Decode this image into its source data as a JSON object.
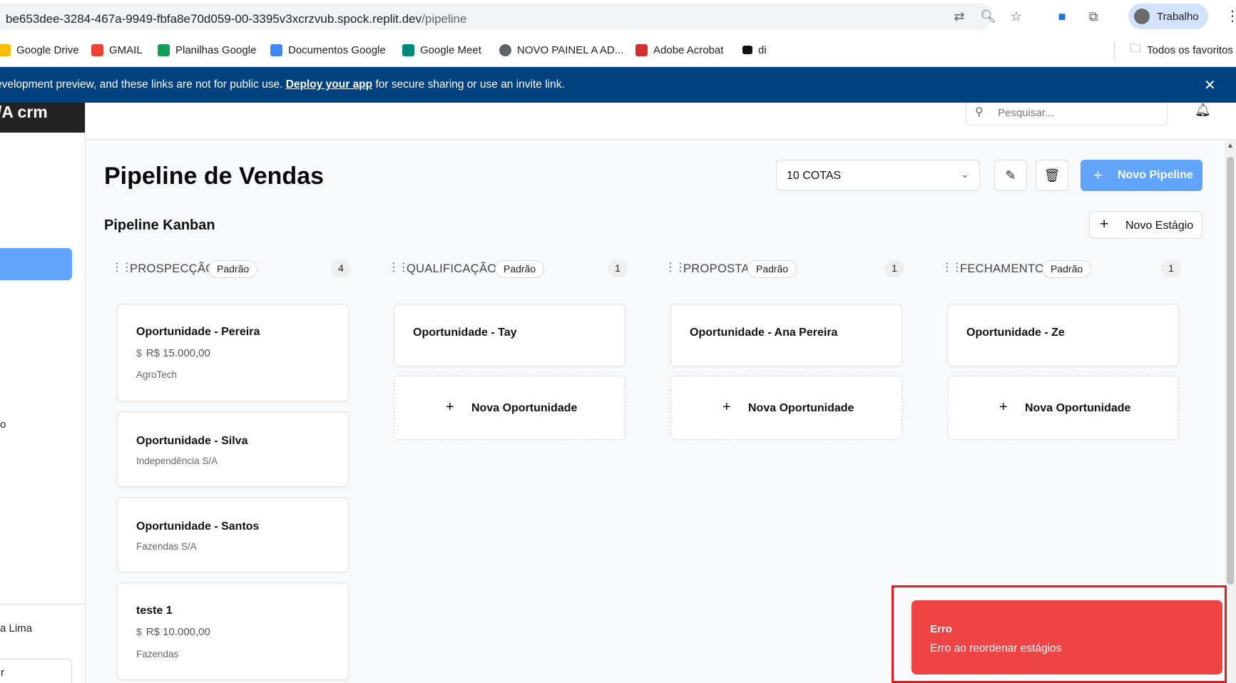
{
  "browser": {
    "url_host": "be653dee-3284-467a-9949-fbfa8e70d059-00-3395v3xcrzvub.spock.replit.dev",
    "url_path": "/pipeline",
    "profile_label": "Trabalho",
    "bookmarks": [
      {
        "label": "Google Drive",
        "icon": "drive-icon",
        "color": "#1a73e8"
      },
      {
        "label": "GMAIL",
        "icon": "gmail-icon",
        "color": "#ea4335"
      },
      {
        "label": "Planilhas Google",
        "icon": "sheets-icon",
        "color": "#0f9d58"
      },
      {
        "label": "Documentos Google",
        "icon": "docs-icon",
        "color": "#4285f4"
      },
      {
        "label": "Google Meet",
        "icon": "meet-icon",
        "color": "#00897b"
      },
      {
        "label": "NOVO PAINEL A AD...",
        "icon": "globe-icon",
        "color": "#5f6368"
      },
      {
        "label": "Adobe Acrobat",
        "icon": "acrobat-icon",
        "color": "#d32f2f"
      },
      {
        "label": "di",
        "icon": "m-icon",
        "color": "#111111"
      }
    ],
    "all_bookmarks_label": "Todos os favoritos"
  },
  "banner": {
    "text_before": "evelopment preview, and these links are not for public use.",
    "link": "Deploy your app",
    "text_after": "for secure sharing or use an invite link."
  },
  "sidebar": {
    "logo_text": "/A crm",
    "fragment_1": "o",
    "user_fragment": "a Lima",
    "bottom_fragment": "r"
  },
  "topbar": {
    "search_placeholder": "Pesquisar..."
  },
  "page": {
    "title": "Pipeline de Vendas",
    "pipeline_select": "10 COTAS",
    "new_pipeline_label": "Novo Pipeline",
    "subtitle": "Pipeline Kanban",
    "new_stage_label": "Novo Estágio"
  },
  "columns": [
    {
      "name": "PROSPECÇÃO",
      "badge": "Padrão",
      "count": "4",
      "cards": [
        {
          "name": "Oportunidade - Pereira",
          "value": "R$ 15.000,00",
          "company": "AgroTech"
        },
        {
          "name": "Oportunidade - Silva",
          "company": "Independência S/A"
        },
        {
          "name": "Oportunidade - Santos",
          "company": "Fazendas S/A"
        },
        {
          "name": "teste 1",
          "value": "R$ 10.000,00",
          "company": "Fazendas"
        }
      ]
    },
    {
      "name": "QUALIFICAÇÃO",
      "badge": "Padrão",
      "count": "1",
      "cards": [
        {
          "name": "Oportunidade - Tay"
        }
      ],
      "new_label": "Nova Oportunidade"
    },
    {
      "name": "PROPOSTA",
      "badge": "Padrão",
      "count": "1",
      "cards": [
        {
          "name": "Oportunidade - Ana Pereira"
        }
      ],
      "new_label": "Nova Oportunidade"
    },
    {
      "name": "FECHAMENTO",
      "badge": "Padrão",
      "count": "1",
      "cards": [
        {
          "name": "Oportunidade - Ze"
        }
      ],
      "new_label": "Nova Oportunidade"
    }
  ],
  "toast": {
    "title": "Erro",
    "description": "Erro ao reordenar estágios",
    "color": "#ef4444"
  }
}
